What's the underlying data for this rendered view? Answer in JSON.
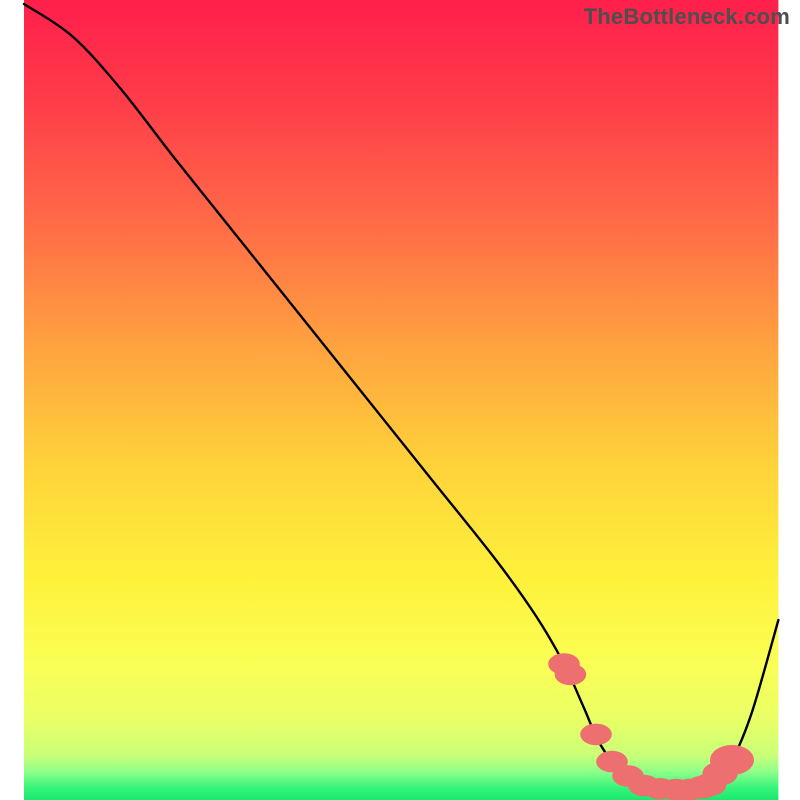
{
  "watermark": "TheBottleneck.com",
  "chart_data": {
    "type": "line",
    "title": "",
    "xlabel": "",
    "ylabel": "",
    "xlim": [
      0,
      100
    ],
    "ylim": [
      0,
      100
    ],
    "grid": false,
    "legend": false,
    "gradient_stops": [
      {
        "offset": 0.0,
        "color": "#ff1f4b"
      },
      {
        "offset": 0.12,
        "color": "#ff3a4a"
      },
      {
        "offset": 0.28,
        "color": "#ff6b47"
      },
      {
        "offset": 0.44,
        "color": "#ffa53f"
      },
      {
        "offset": 0.58,
        "color": "#ffd23a"
      },
      {
        "offset": 0.72,
        "color": "#fef13a"
      },
      {
        "offset": 0.83,
        "color": "#faff55"
      },
      {
        "offset": 0.9,
        "color": "#e9ff66"
      },
      {
        "offset": 0.945,
        "color": "#c8ff78"
      },
      {
        "offset": 0.965,
        "color": "#8dff8a"
      },
      {
        "offset": 0.985,
        "color": "#36f57a"
      },
      {
        "offset": 1.0,
        "color": "#1ae86f"
      }
    ],
    "series": [
      {
        "name": "bottleneck-curve",
        "color": "#000000",
        "x": [
          3.0,
          9.0,
          15.0,
          22.0,
          30.0,
          38.0,
          46.0,
          54.0,
          62.0,
          67.0,
          70.5,
          73.0,
          75.0,
          78.0,
          82.0,
          86.0,
          89.0,
          91.5,
          94.0,
          97.3
        ],
        "values": [
          99.5,
          95.5,
          89.0,
          80.0,
          70.0,
          60.0,
          50.0,
          40.0,
          30.0,
          23.0,
          17.0,
          11.5,
          7.0,
          3.2,
          1.4,
          1.2,
          2.0,
          5.0,
          11.0,
          22.5
        ]
      }
    ],
    "scatter": {
      "name": "optimal-zone-markers",
      "color": "#ed6f6f",
      "x": [
        70.5,
        71.3,
        74.5,
        76.5,
        78.5,
        80.5,
        82.5,
        84.5,
        86.2,
        87.8,
        88.7,
        90.0,
        91.5
      ],
      "values": [
        17.0,
        15.7,
        8.2,
        4.8,
        3.0,
        1.8,
        1.4,
        1.3,
        1.3,
        1.6,
        1.9,
        3.3,
        5.0
      ],
      "sizes": [
        3.6,
        3.6,
        3.6,
        3.6,
        3.6,
        3.6,
        3.6,
        3.6,
        3.6,
        3.8,
        3.8,
        4.0,
        5.0
      ]
    },
    "inner_box": {
      "x0": 3.0,
      "y0": 0.0,
      "x1": 97.3,
      "y1": 100.0
    }
  }
}
